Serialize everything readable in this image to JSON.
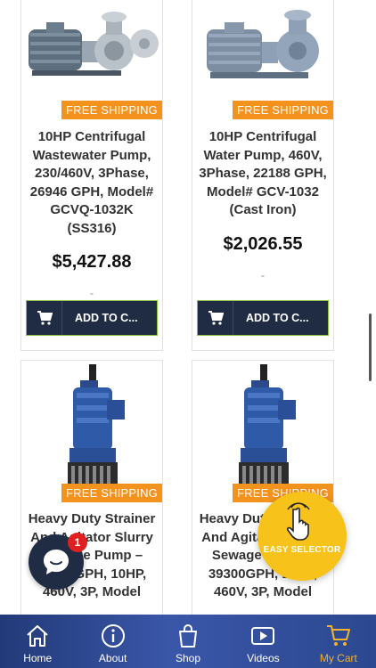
{
  "products": [
    {
      "badge": "FREE SHIPPING",
      "title": "10HP Centrifugal Wastewater Pump, 230/460V, 3Phase, 26946 GPH, Model# GCVQ-1032K (SS316)",
      "price": "$5,427.88",
      "dash": "-",
      "cart_label": "ADD TO C..."
    },
    {
      "badge": "FREE SHIPPING",
      "title": "10HP Centrifugal Water Pump, 460V, 3Phase, 22188 GPH, Model# GCV-1032 (Cast Iron)",
      "price": "$2,026.55",
      "dash": "-",
      "cart_label": "ADD TO C..."
    },
    {
      "badge": "FREE SHIPPING",
      "title": "Heavy Duty Strainer And Agitator Slurry Sewage Pump – 39300GPH, 10HP, 460V, 3P, Model"
    },
    {
      "badge": "FREE SHIPPING",
      "title": "Heavy Duty Strainer And Agitator Slurry Sewage Pump – 39300GPH, 10HP, 460V, 3P, Model"
    }
  ],
  "chat": {
    "count": "1"
  },
  "easy_selector": {
    "label": "EASY SELECTOR"
  },
  "nav": [
    {
      "label": "Home",
      "icon": "home-icon"
    },
    {
      "label": "About",
      "icon": "info-icon"
    },
    {
      "label": "Shop",
      "icon": "shopping-bag-icon"
    },
    {
      "label": "Videos",
      "icon": "video-icon"
    },
    {
      "label": "My Cart",
      "icon": "cart-icon",
      "active": true
    }
  ],
  "colors": {
    "badge": "#f3931d",
    "cart_button": "#1f2c44",
    "cart_border": "#88c43a",
    "nav_active": "#f3b32c",
    "easy_selector": "#f7c21a"
  }
}
